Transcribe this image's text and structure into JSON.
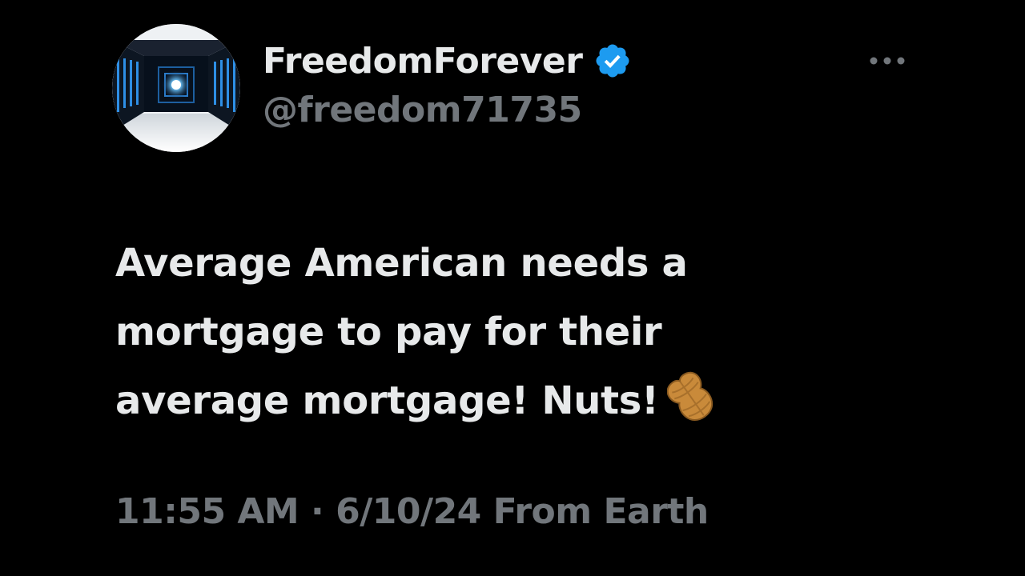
{
  "author": {
    "display_name": "FreedomForever",
    "handle": "@freedom71735",
    "verified": true,
    "verified_color": "#1d9bf0",
    "avatar_icon": "server-room-avatar"
  },
  "more_icon": "more-horizontal-icon",
  "tweet": {
    "text_lines": [
      "Average American needs a",
      "mortgage to pay for their",
      "average mortgage! Nuts!"
    ],
    "emoji": "peanut-emoji"
  },
  "meta": {
    "time": "11:55 AM",
    "separator": " · ",
    "date": "6/10/24",
    "source": " From Earth"
  },
  "colors": {
    "background": "#000000",
    "primary_text": "#e7e9ea",
    "secondary_text": "#71767b"
  }
}
